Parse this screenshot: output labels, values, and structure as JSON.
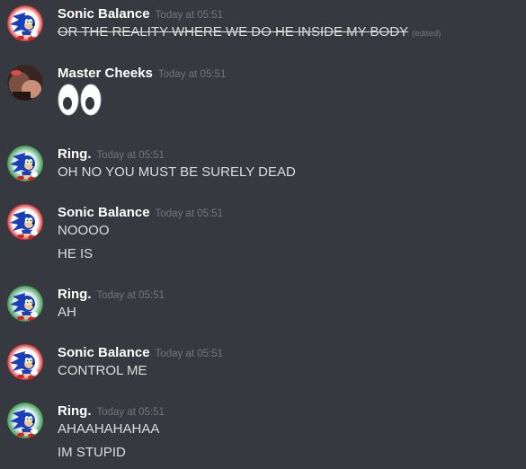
{
  "messages": [
    {
      "avatar": "sonic-avatar",
      "username": "Sonic Balance",
      "timestamp": "Today at 05:51",
      "lines": [
        "OR THE REALITY WHERE WE DO HE INSIDE MY BODY"
      ],
      "edited_label": "(edited)"
    },
    {
      "avatar": "photo-avatar",
      "username": "Master Cheeks",
      "timestamp": "Today at 05:51",
      "emoji": "eyes-emoji"
    },
    {
      "avatar": "sonic-avatar-alt",
      "username": "Ring.",
      "timestamp": "Today at 05:51",
      "lines": [
        "OH NO YOU MUST BE SURELY DEAD"
      ]
    },
    {
      "avatar": "sonic-avatar",
      "username": "Sonic Balance",
      "timestamp": "Today at 05:51",
      "lines": [
        "NOOOO",
        "HE IS"
      ]
    },
    {
      "avatar": "sonic-avatar-alt",
      "username": "Ring.",
      "timestamp": "Today at 05:51",
      "lines": [
        "AH"
      ]
    },
    {
      "avatar": "sonic-avatar",
      "username": "Sonic Balance",
      "timestamp": "Today at 05:51",
      "lines": [
        "CONTROL ME"
      ]
    },
    {
      "avatar": "sonic-avatar-alt",
      "username": "Ring.",
      "timestamp": "Today at 05:51",
      "lines": [
        "AHAAHAHAHAA",
        "IM STUPID"
      ]
    }
  ],
  "colors": {
    "background": "#36393f",
    "username": "#ffffff",
    "message_text": "#dcddde",
    "timestamp": "#72767d"
  }
}
